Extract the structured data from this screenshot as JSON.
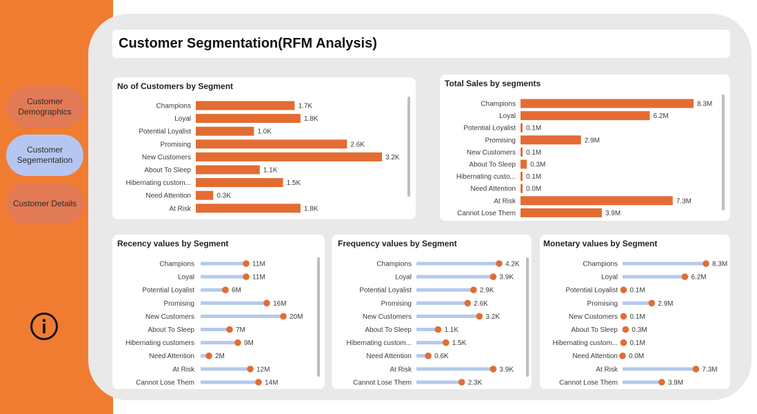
{
  "page": {
    "title": "Customer Segmentation(RFM Analysis)"
  },
  "nav": {
    "items": [
      {
        "label": "Customer Demographics"
      },
      {
        "label": "Customer Segementation"
      },
      {
        "label": "Customer Details"
      }
    ],
    "active_index": 1,
    "icon": "info-icon"
  },
  "colors": {
    "sidebar": "#F07C32",
    "nav_button": "#E27A55",
    "nav_active": "#B5C7F0",
    "bar": "#E36C33",
    "stem": "#B4C9EC",
    "dot": "#E36C33"
  },
  "chart_data": [
    {
      "id": "customers",
      "type": "bar",
      "orientation": "horizontal",
      "title": "No of Customers by Segment",
      "categories": [
        "Champions",
        "Loyal",
        "Potential Loyalist",
        "Promising",
        "New Customers",
        "About To Sleep",
        "Hibernating custom...",
        "Need Attention",
        "At Risk"
      ],
      "values": [
        1700,
        1800,
        1000,
        2600,
        3200,
        1100,
        1500,
        300,
        1800
      ],
      "labels": [
        "1.7K",
        "1.8K",
        "1.0K",
        "2.6K",
        "3.2K",
        "1.1K",
        "1.5K",
        "0.3K",
        "1.8K"
      ]
    },
    {
      "id": "sales",
      "type": "bar",
      "orientation": "horizontal",
      "title": "Total Sales by segments",
      "categories": [
        "Champions",
        "Loyal",
        "Potential Loyalist",
        "Promising",
        "New Customers",
        "About To Sleep",
        "Hibernating custo...",
        "Need Attention",
        "At Risk",
        "Cannot Lose Them"
      ],
      "values": [
        8.3,
        6.2,
        0.1,
        2.9,
        0.1,
        0.3,
        0.1,
        0.0,
        7.3,
        3.9
      ],
      "labels": [
        "8.3M",
        "6.2M",
        "0.1M",
        "2.9M",
        "0.1M",
        "0.3M",
        "0.1M",
        "0.0M",
        "7.3M",
        "3.9M"
      ]
    },
    {
      "id": "recency",
      "type": "lollipop",
      "title": "Recency values by Segment",
      "categories": [
        "Champions",
        "Loyal",
        "Potential Loyalist",
        "Promising",
        "New Customers",
        "About To Sleep",
        "Hibernating customers",
        "Need Attention",
        "At Risk",
        "Cannot Lose Them"
      ],
      "values": [
        11,
        11,
        6,
        16,
        20,
        7,
        9,
        2,
        12,
        14
      ],
      "labels": [
        "11M",
        "11M",
        "6M",
        "16M",
        "20M",
        "7M",
        "9M",
        "2M",
        "12M",
        "14M"
      ]
    },
    {
      "id": "frequency",
      "type": "lollipop",
      "title": "Frequency values by Segment",
      "categories": [
        "Champions",
        "Loyal",
        "Potential Loyalist",
        "Promising",
        "New Customers",
        "About To Sleep",
        "Hibernating custom...",
        "Need Attention",
        "At Risk",
        "Cannot Lose Them"
      ],
      "values": [
        4.2,
        3.9,
        2.9,
        2.6,
        3.2,
        1.1,
        1.5,
        0.6,
        3.9,
        2.3
      ],
      "labels": [
        "4.2K",
        "3.9K",
        "2.9K",
        "2.6K",
        "3.2K",
        "1.1K",
        "1.5K",
        "0.6K",
        "3.9K",
        "2.3K"
      ]
    },
    {
      "id": "monetary",
      "type": "lollipop",
      "title": "Monetary values by Segment",
      "categories": [
        "Champions",
        "Loyal",
        "Potential Loyalist",
        "Promising",
        "New Customers",
        "About To Sleep",
        "Hibernating custom...",
        "Need Attention",
        "At Risk",
        "Cannot Lose Them"
      ],
      "values": [
        8.3,
        6.2,
        0.1,
        2.9,
        0.1,
        0.3,
        0.1,
        0.0,
        7.3,
        3.9
      ],
      "labels": [
        "8.3M",
        "6.2M",
        "0.1M",
        "2.9M",
        "0.1M",
        "0.3M",
        "0.1M",
        "0.0M",
        "7.3M",
        "3.9M"
      ]
    }
  ]
}
